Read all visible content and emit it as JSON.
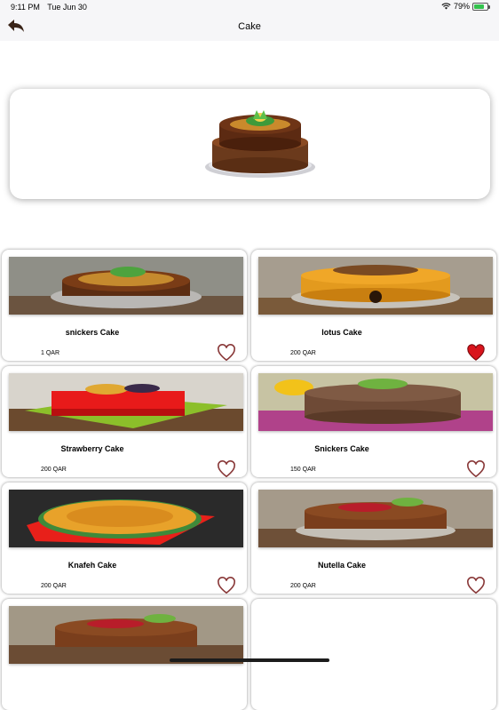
{
  "status_bar": {
    "time": "9:11 PM",
    "date": "Tue Jun 30",
    "battery": "79%"
  },
  "nav": {
    "title": "Cake"
  },
  "colors": {
    "heart_active": "#d9141c",
    "heart_inactive": "#8a3a3a",
    "battery": "#33c24d"
  },
  "products": [
    {
      "name": "snickers Cake",
      "price": "1 QAR",
      "favorite": false
    },
    {
      "name": "lotus Cake",
      "price": "200 QAR",
      "favorite": true
    },
    {
      "name": "Strawberry Cake",
      "price": "200 QAR",
      "favorite": false
    },
    {
      "name": "Snickers Cake",
      "price": "150 QAR",
      "favorite": false
    },
    {
      "name": "Knafeh Cake",
      "price": "200 QAR",
      "favorite": false
    },
    {
      "name": "Nutella Cake",
      "price": "200 QAR",
      "favorite": false
    }
  ]
}
